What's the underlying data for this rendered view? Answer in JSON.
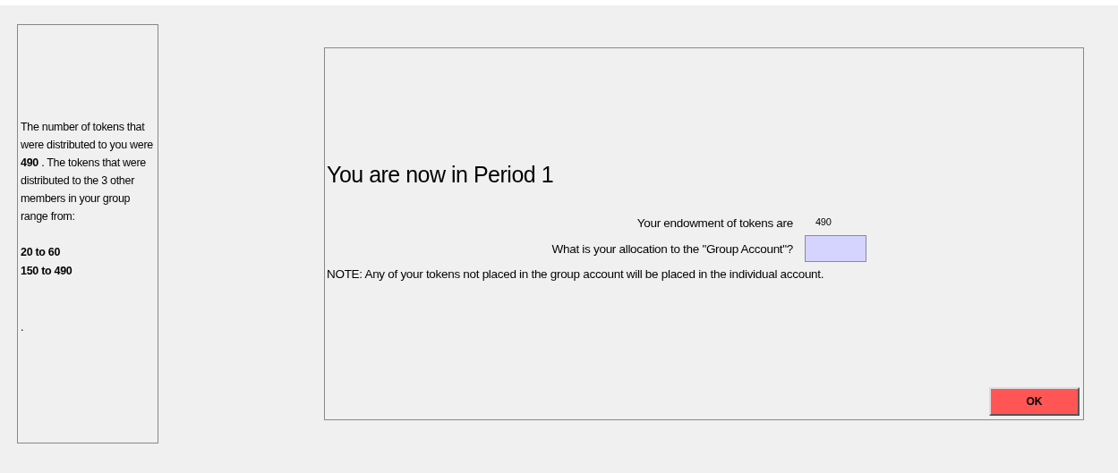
{
  "side_panel": {
    "message": " The number of tokens that were distributed to you were **490** . The tokens that were distributed to the 3 other members in your group range from:",
    "ranges": [
      "20 to 60",
      "150 to 490"
    ],
    "footer": "."
  },
  "main": {
    "heading": "You are now in Period 1",
    "endowment": {
      "label": "Your endowment of tokens are",
      "value": "490"
    },
    "allocation": {
      "label": "What is your allocation to the \"Group Account\"?"
    },
    "note": "NOTE: Any of your tokens not placed in the group account will be placed in the individual account.",
    "ok_button": "OK"
  }
}
